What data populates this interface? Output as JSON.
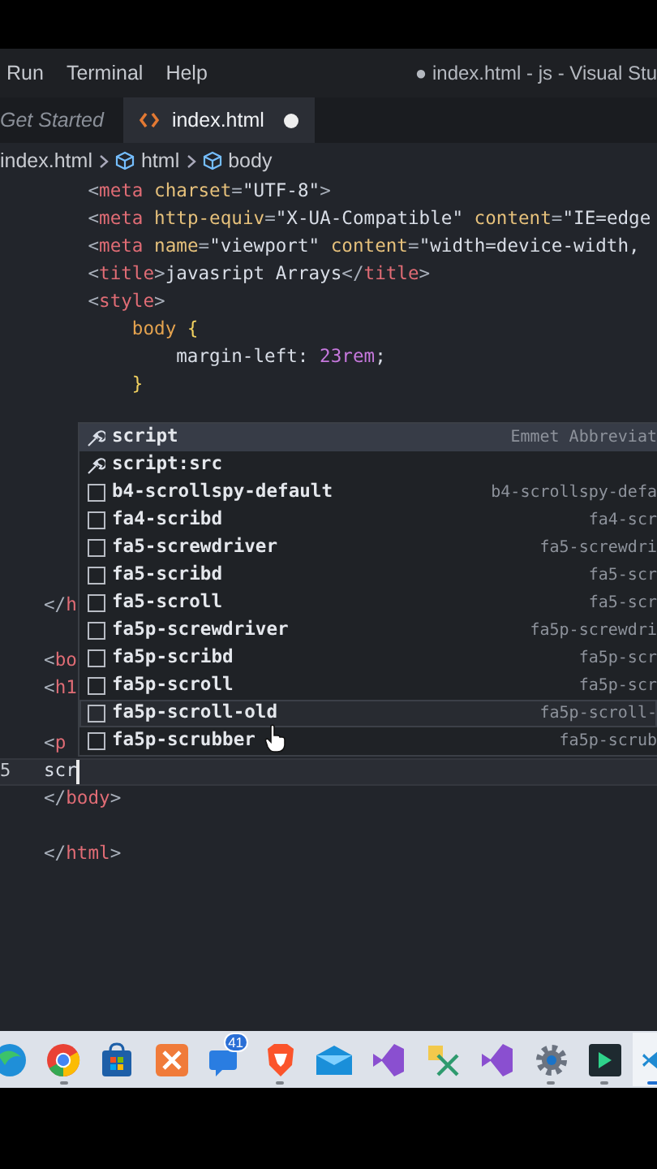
{
  "menu_bar": {
    "items": [
      "Run",
      "Terminal",
      "Help"
    ],
    "title": "● index.html - js - Visual Stu"
  },
  "tabs": [
    {
      "label": "Get Started",
      "selected": false,
      "dirty": false,
      "icon": false
    },
    {
      "label": "index.html",
      "selected": true,
      "dirty": true,
      "icon": true
    }
  ],
  "breadcrumb": [
    {
      "label": "index.html",
      "symbol": false
    },
    {
      "label": "html",
      "symbol": true
    },
    {
      "label": "body",
      "symbol": true
    }
  ],
  "editor": {
    "lines": [
      {
        "current": false,
        "tokens": [
          {
            "kind": "punct",
            "text": "    <"
          },
          {
            "kind": "tag",
            "text": "meta"
          },
          {
            "kind": "attr",
            "text": " charset"
          },
          {
            "kind": "punct",
            "text": "="
          },
          {
            "kind": "string",
            "text": "\"UTF-8\""
          },
          {
            "kind": "punct",
            "text": ">"
          }
        ]
      },
      {
        "current": false,
        "tokens": [
          {
            "kind": "punct",
            "text": "    <"
          },
          {
            "kind": "tag",
            "text": "meta"
          },
          {
            "kind": "attr",
            "text": " http-equiv"
          },
          {
            "kind": "punct",
            "text": "="
          },
          {
            "kind": "string",
            "text": "\"X-UA-Compatible\""
          },
          {
            "kind": "attr",
            "text": " content"
          },
          {
            "kind": "punct",
            "text": "="
          },
          {
            "kind": "string",
            "text": "\"IE=edge"
          }
        ]
      },
      {
        "current": false,
        "tokens": [
          {
            "kind": "punct",
            "text": "    <"
          },
          {
            "kind": "tag",
            "text": "meta"
          },
          {
            "kind": "attr",
            "text": " name"
          },
          {
            "kind": "punct",
            "text": "="
          },
          {
            "kind": "string",
            "text": "\"viewport\""
          },
          {
            "kind": "attr",
            "text": " content"
          },
          {
            "kind": "punct",
            "text": "="
          },
          {
            "kind": "string",
            "text": "\"width=device-width,"
          }
        ]
      },
      {
        "current": false,
        "tokens": [
          {
            "kind": "punct",
            "text": "    <"
          },
          {
            "kind": "tag",
            "text": "title"
          },
          {
            "kind": "punct",
            "text": ">"
          },
          {
            "kind": "text",
            "text": "javasript Arrays"
          },
          {
            "kind": "punct",
            "text": "</"
          },
          {
            "kind": "tag",
            "text": "title"
          },
          {
            "kind": "punct",
            "text": ">"
          }
        ]
      },
      {
        "current": false,
        "tokens": [
          {
            "kind": "punct",
            "text": "    <"
          },
          {
            "kind": "tag",
            "text": "style"
          },
          {
            "kind": "punct",
            "text": ">"
          }
        ]
      },
      {
        "current": false,
        "tokens": [
          {
            "kind": "selector",
            "text": "        body"
          },
          {
            "kind": "brace",
            "text": " {"
          }
        ]
      },
      {
        "current": false,
        "tokens": [
          {
            "kind": "text",
            "text": "            margin-left: "
          },
          {
            "kind": "number",
            "text": "23rem"
          },
          {
            "kind": "text",
            "text": ";"
          }
        ]
      },
      {
        "current": false,
        "tokens": [
          {
            "kind": "brace",
            "text": "        }"
          }
        ]
      },
      {
        "current": false
      },
      {
        "current": false
      },
      {
        "current": false
      },
      {
        "current": false
      },
      {
        "current": false
      },
      {
        "current": false
      },
      {
        "current": false
      },
      {
        "current": false,
        "tokens": [
          {
            "kind": "punct",
            "text": "</"
          },
          {
            "kind": "tag",
            "text": "h"
          }
        ]
      },
      {
        "current": false
      },
      {
        "current": false,
        "tokens": [
          {
            "kind": "punct",
            "text": "<"
          },
          {
            "kind": "tag",
            "text": "bo"
          }
        ]
      },
      {
        "current": false,
        "tokens": [
          {
            "kind": "punct",
            "text": "<"
          },
          {
            "kind": "tag",
            "text": "h1"
          }
        ]
      },
      {
        "current": false
      },
      {
        "current": false,
        "tokens": [
          {
            "kind": "punct",
            "text": "<"
          },
          {
            "kind": "tag",
            "text": "p"
          }
        ]
      },
      {
        "current": true,
        "line_number": "5",
        "tokens": [
          {
            "kind": "text",
            "text": "scr"
          }
        ]
      },
      {
        "current": false,
        "tokens": [
          {
            "kind": "punct",
            "text": "</"
          },
          {
            "kind": "tag",
            "text": "body"
          },
          {
            "kind": "punct",
            "text": ">"
          }
        ]
      },
      {
        "current": false
      },
      {
        "current": false,
        "tokens": [
          {
            "kind": "punct",
            "text": "</"
          },
          {
            "kind": "tag",
            "text": "html"
          },
          {
            "kind": "punct",
            "text": ">"
          }
        ]
      }
    ]
  },
  "suggestions": [
    {
      "kind": "emmet",
      "label": "script",
      "detail": "Emmet Abbreviat",
      "selected": true,
      "hovered": false
    },
    {
      "kind": "emmet",
      "label": "script:src",
      "selected": false,
      "hovered": false
    },
    {
      "kind": "snippet",
      "label": "b4-scrollspy-default",
      "detail": "b4-scrollspy-defa",
      "selected": false,
      "hovered": false
    },
    {
      "kind": "snippet",
      "label": "fa4-scribd",
      "detail": "fa4-scr",
      "selected": false,
      "hovered": false
    },
    {
      "kind": "snippet",
      "label": "fa5-screwdriver",
      "detail": "fa5-screwdri",
      "selected": false,
      "hovered": false
    },
    {
      "kind": "snippet",
      "label": "fa5-scribd",
      "detail": "fa5-scr",
      "selected": false,
      "hovered": false
    },
    {
      "kind": "snippet",
      "label": "fa5-scroll",
      "detail": "fa5-scr",
      "selected": false,
      "hovered": false
    },
    {
      "kind": "snippet",
      "label": "fa5p-screwdriver",
      "detail": "fa5p-screwdri",
      "selected": false,
      "hovered": false
    },
    {
      "kind": "snippet",
      "label": "fa5p-scribd",
      "detail": "fa5p-scr",
      "selected": false,
      "hovered": false
    },
    {
      "kind": "snippet",
      "label": "fa5p-scroll",
      "detail": "fa5p-scr",
      "selected": false,
      "hovered": false
    },
    {
      "kind": "snippet",
      "label": "fa5p-scroll-old",
      "detail": "fa5p-scroll-",
      "selected": false,
      "hovered": true
    },
    {
      "kind": "snippet",
      "label": "fa5p-scrubber",
      "detail": "fa5p-scrub",
      "selected": false,
      "hovered": false
    }
  ],
  "taskbar": [
    {
      "kind": "globe",
      "running": false,
      "selected": false
    },
    {
      "kind": "chrome",
      "running": true,
      "selected": false
    },
    {
      "kind": "store",
      "running": false,
      "selected": false
    },
    {
      "kind": "xampp",
      "running": false,
      "selected": false
    },
    {
      "kind": "chat",
      "running": false,
      "selected": false,
      "badge": "41"
    },
    {
      "kind": "shield",
      "running": true,
      "selected": false
    },
    {
      "kind": "mail",
      "running": false,
      "selected": false
    },
    {
      "kind": "vs",
      "running": false,
      "selected": false
    },
    {
      "kind": "tools",
      "running": false,
      "selected": false
    },
    {
      "kind": "vs",
      "running": false,
      "selected": false
    },
    {
      "kind": "gear",
      "running": true,
      "selected": false
    },
    {
      "kind": "terminal",
      "running": true,
      "selected": false
    },
    {
      "kind": "code",
      "running": true,
      "selected": true
    }
  ]
}
